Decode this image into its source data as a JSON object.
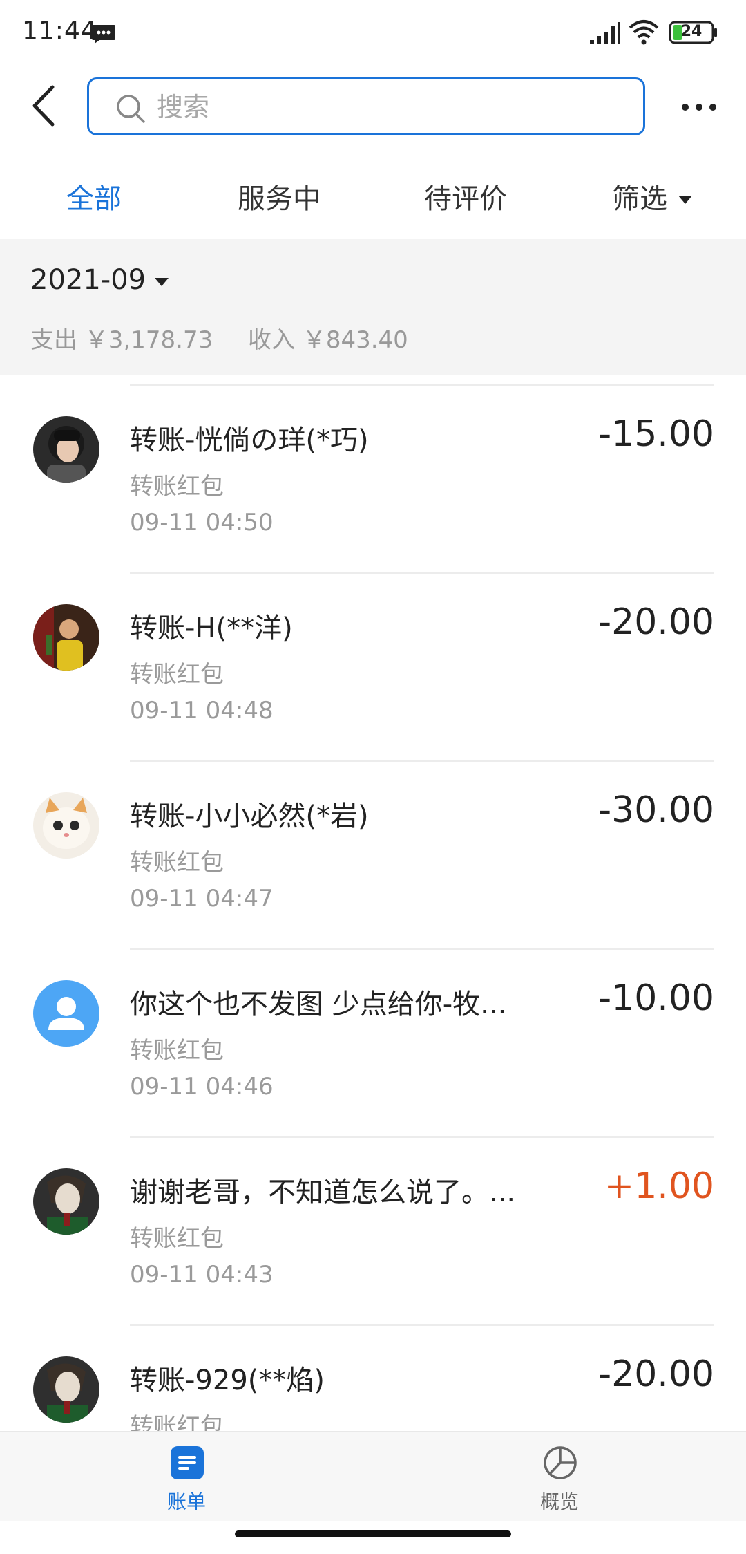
{
  "status_bar": {
    "time": "11:44",
    "battery": "24"
  },
  "search": {
    "placeholder": "搜索",
    "value": ""
  },
  "tabs": [
    {
      "label": "全部",
      "active": true
    },
    {
      "label": "服务中",
      "active": false
    },
    {
      "label": "待评价",
      "active": false
    },
    {
      "label": "筛选",
      "active": false
    }
  ],
  "summary": {
    "month": "2021-09",
    "expense": "支出 ￥3,178.73",
    "income": "收入 ￥843.40"
  },
  "transactions": [
    {
      "title": "转账-恍倘の珜(*巧)",
      "subtitle": "转账红包",
      "time": "09-11  04:50",
      "amount": "-15.00",
      "avatar": "girl-photo"
    },
    {
      "title": "转账-H(**洋)",
      "subtitle": "转账红包",
      "time": "09-11  04:48",
      "amount": "-20.00",
      "avatar": "man-photo"
    },
    {
      "title": "转账-小小必然(*岩)",
      "subtitle": "转账红包",
      "time": "09-11  04:47",
      "amount": "-30.00",
      "avatar": "cat-photo"
    },
    {
      "title": "你这个也不发图 少点给你-牧...",
      "subtitle": "转账红包",
      "time": "09-11  04:46",
      "amount": "-10.00",
      "avatar": "default-user"
    },
    {
      "title": "谢谢老哥，不知道怎么说了。...",
      "subtitle": "转账红包",
      "time": "09-11  04:43",
      "amount": "+1.00",
      "avatar": "joker-photo"
    },
    {
      "title": "转账-929(**焰)",
      "subtitle": "转账红包",
      "time": "",
      "amount": "-20.00",
      "avatar": "joker-photo"
    }
  ],
  "bottom_nav": {
    "bills": "账单",
    "overview": "概览"
  },
  "colors": {
    "accent": "#1a73d9",
    "positive_amount": "#e0541f"
  }
}
